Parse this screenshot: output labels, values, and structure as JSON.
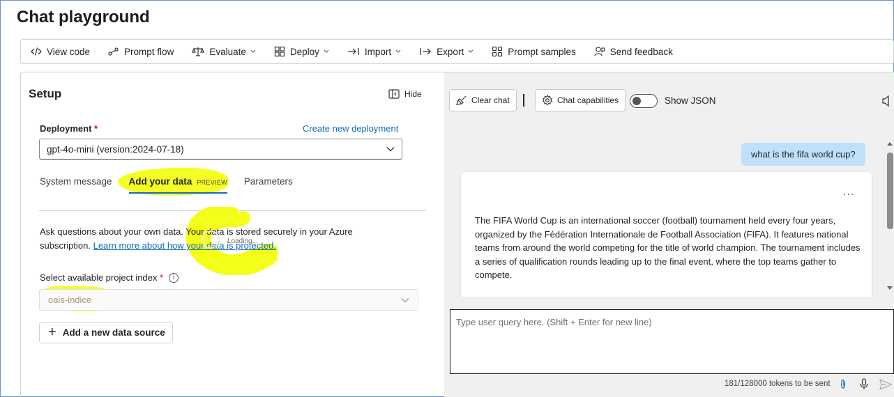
{
  "page": {
    "title": "Chat playground"
  },
  "toolbar": {
    "items": [
      {
        "label": "View code",
        "icon": "code-icon"
      },
      {
        "label": "Prompt flow",
        "icon": "flow-icon"
      },
      {
        "label": "Evaluate",
        "icon": "balance-icon",
        "dropdown": true
      },
      {
        "label": "Deploy",
        "icon": "cube-icon",
        "dropdown": true
      },
      {
        "label": "Import",
        "icon": "import-icon",
        "dropdown": true
      },
      {
        "label": "Export",
        "icon": "export-icon",
        "dropdown": true
      },
      {
        "label": "Prompt samples",
        "icon": "grid-icon"
      },
      {
        "label": "Send feedback",
        "icon": "feedback-icon"
      }
    ]
  },
  "setup": {
    "title": "Setup",
    "hide_label": "Hide",
    "deployment_label": "Deployment",
    "required_mark": "*",
    "create_link": "Create new deployment",
    "deployment_value": "gpt-4o-mini (version:2024-07-18)",
    "tabs": {
      "system": "System message",
      "data": "Add your data",
      "data_badge": "PREVIEW",
      "params": "Parameters"
    },
    "info_text": "Ask questions about your own data. Your data is stored securely in your Azure subscription. ",
    "info_link": "Learn more about how your data is protected.",
    "loading": "Loading...",
    "index_label": "Select available project index",
    "info_icon": "i",
    "index_value": "oais-indice",
    "add_source": "Add a new data source"
  },
  "chat": {
    "clear_chat": "Clear chat",
    "capabilities": "Chat capabilities",
    "show_json": "Show JSON",
    "user_message": "what is the fifa world cup?",
    "more_dots": "...",
    "assistant_message": "The FIFA World Cup is an international soccer (football) tournament held every four years, organized by the Fédération Internationale de Football Association (FIFA). It features national teams from around the world competing for the title of world champion. The tournament includes a series of qualification rounds leading up to the final event, where the top teams gather to compete.",
    "input_placeholder": "Type user query here. (Shift + Enter for new line)",
    "tokens": "181/128000 tokens to be sent"
  },
  "colors": {
    "accent": "#0f6cbd",
    "highlight": "#f2ff00",
    "user_bubble": "#bfe0fa",
    "chat_bg": "#f0f0f0"
  }
}
